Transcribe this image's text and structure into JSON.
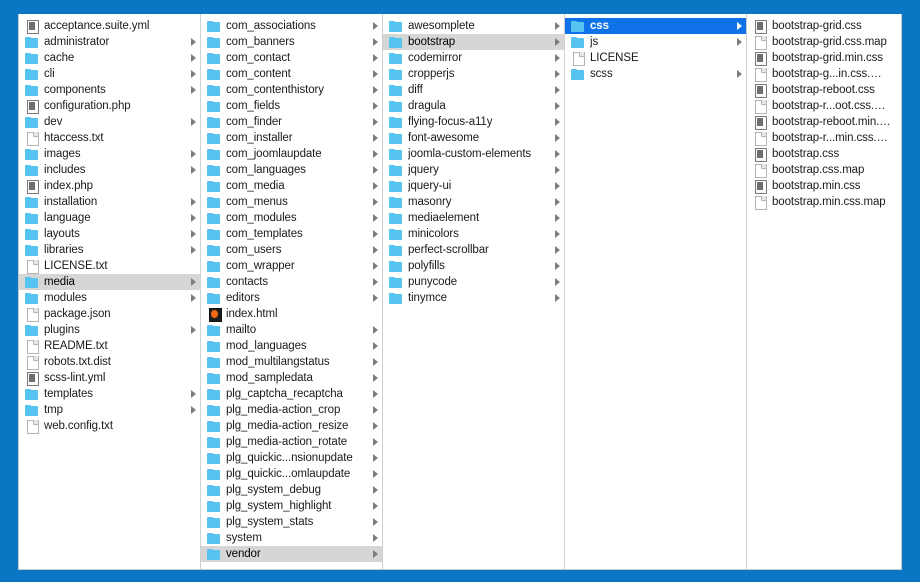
{
  "window": {
    "title": "Finder Column View",
    "desktop_color": "#0a76c4",
    "selection_color": "#1072e8",
    "inactive_selection_color": "#d6d6d6",
    "folder_icon_color": "#57c3f0"
  },
  "columns": [
    {
      "name": "joomla-root",
      "items": [
        {
          "label": "acceptance.suite.yml",
          "icon": "code-file-icon",
          "arrow": false,
          "state": "normal"
        },
        {
          "label": "administrator",
          "icon": "folder-icon",
          "arrow": true,
          "state": "normal"
        },
        {
          "label": "cache",
          "icon": "folder-icon",
          "arrow": true,
          "state": "normal"
        },
        {
          "label": "cli",
          "icon": "folder-icon",
          "arrow": true,
          "state": "normal"
        },
        {
          "label": "components",
          "icon": "folder-icon",
          "arrow": true,
          "state": "normal"
        },
        {
          "label": "configuration.php",
          "icon": "code-file-icon",
          "arrow": false,
          "state": "normal"
        },
        {
          "label": "dev",
          "icon": "folder-icon",
          "arrow": true,
          "state": "normal"
        },
        {
          "label": "htaccess.txt",
          "icon": "document-icon",
          "arrow": false,
          "state": "normal"
        },
        {
          "label": "images",
          "icon": "folder-icon",
          "arrow": true,
          "state": "normal"
        },
        {
          "label": "includes",
          "icon": "folder-icon",
          "arrow": true,
          "state": "normal"
        },
        {
          "label": "index.php",
          "icon": "code-file-icon",
          "arrow": false,
          "state": "normal"
        },
        {
          "label": "installation",
          "icon": "folder-icon",
          "arrow": true,
          "state": "normal"
        },
        {
          "label": "language",
          "icon": "folder-icon",
          "arrow": true,
          "state": "normal"
        },
        {
          "label": "layouts",
          "icon": "folder-icon",
          "arrow": true,
          "state": "normal"
        },
        {
          "label": "libraries",
          "icon": "folder-icon",
          "arrow": true,
          "state": "normal"
        },
        {
          "label": "LICENSE.txt",
          "icon": "document-icon",
          "arrow": false,
          "state": "normal"
        },
        {
          "label": "media",
          "icon": "folder-icon",
          "arrow": true,
          "state": "selected-inactive"
        },
        {
          "label": "modules",
          "icon": "folder-icon",
          "arrow": true,
          "state": "normal"
        },
        {
          "label": "package.json",
          "icon": "document-icon",
          "arrow": false,
          "state": "normal"
        },
        {
          "label": "plugins",
          "icon": "folder-icon",
          "arrow": true,
          "state": "normal"
        },
        {
          "label": "README.txt",
          "icon": "document-icon",
          "arrow": false,
          "state": "normal"
        },
        {
          "label": "robots.txt.dist",
          "icon": "document-icon",
          "arrow": false,
          "state": "normal"
        },
        {
          "label": "scss-lint.yml",
          "icon": "code-file-icon",
          "arrow": false,
          "state": "normal"
        },
        {
          "label": "templates",
          "icon": "folder-icon",
          "arrow": true,
          "state": "normal"
        },
        {
          "label": "tmp",
          "icon": "folder-icon",
          "arrow": true,
          "state": "normal"
        },
        {
          "label": "web.config.txt",
          "icon": "document-icon",
          "arrow": false,
          "state": "normal"
        }
      ]
    },
    {
      "name": "media",
      "items": [
        {
          "label": "com_associations",
          "icon": "folder-icon",
          "arrow": true,
          "state": "normal"
        },
        {
          "label": "com_banners",
          "icon": "folder-icon",
          "arrow": true,
          "state": "normal"
        },
        {
          "label": "com_contact",
          "icon": "folder-icon",
          "arrow": true,
          "state": "normal"
        },
        {
          "label": "com_content",
          "icon": "folder-icon",
          "arrow": true,
          "state": "normal"
        },
        {
          "label": "com_contenthistory",
          "icon": "folder-icon",
          "arrow": true,
          "state": "normal"
        },
        {
          "label": "com_fields",
          "icon": "folder-icon",
          "arrow": true,
          "state": "normal"
        },
        {
          "label": "com_finder",
          "icon": "folder-icon",
          "arrow": true,
          "state": "normal"
        },
        {
          "label": "com_installer",
          "icon": "folder-icon",
          "arrow": true,
          "state": "normal"
        },
        {
          "label": "com_joomlaupdate",
          "icon": "folder-icon",
          "arrow": true,
          "state": "normal"
        },
        {
          "label": "com_languages",
          "icon": "folder-icon",
          "arrow": true,
          "state": "normal"
        },
        {
          "label": "com_media",
          "icon": "folder-icon",
          "arrow": true,
          "state": "normal"
        },
        {
          "label": "com_menus",
          "icon": "folder-icon",
          "arrow": true,
          "state": "normal"
        },
        {
          "label": "com_modules",
          "icon": "folder-icon",
          "arrow": true,
          "state": "normal"
        },
        {
          "label": "com_templates",
          "icon": "folder-icon",
          "arrow": true,
          "state": "normal"
        },
        {
          "label": "com_users",
          "icon": "folder-icon",
          "arrow": true,
          "state": "normal"
        },
        {
          "label": "com_wrapper",
          "icon": "folder-icon",
          "arrow": true,
          "state": "normal"
        },
        {
          "label": "contacts",
          "icon": "folder-icon",
          "arrow": true,
          "state": "normal"
        },
        {
          "label": "editors",
          "icon": "folder-icon",
          "arrow": true,
          "state": "normal"
        },
        {
          "label": "index.html",
          "icon": "html-file-icon",
          "arrow": false,
          "state": "normal"
        },
        {
          "label": "mailto",
          "icon": "folder-icon",
          "arrow": true,
          "state": "normal"
        },
        {
          "label": "mod_languages",
          "icon": "folder-icon",
          "arrow": true,
          "state": "normal"
        },
        {
          "label": "mod_multilangstatus",
          "icon": "folder-icon",
          "arrow": true,
          "state": "normal"
        },
        {
          "label": "mod_sampledata",
          "icon": "folder-icon",
          "arrow": true,
          "state": "normal"
        },
        {
          "label": "plg_captcha_recaptcha",
          "icon": "folder-icon",
          "arrow": true,
          "state": "normal"
        },
        {
          "label": "plg_media-action_crop",
          "icon": "folder-icon",
          "arrow": true,
          "state": "normal"
        },
        {
          "label": "plg_media-action_resize",
          "icon": "folder-icon",
          "arrow": true,
          "state": "normal"
        },
        {
          "label": "plg_media-action_rotate",
          "icon": "folder-icon",
          "arrow": true,
          "state": "normal"
        },
        {
          "label": "plg_quickic...nsionupdate",
          "icon": "folder-icon",
          "arrow": true,
          "state": "normal"
        },
        {
          "label": "plg_quickic...omlaupdate",
          "icon": "folder-icon",
          "arrow": true,
          "state": "normal"
        },
        {
          "label": "plg_system_debug",
          "icon": "folder-icon",
          "arrow": true,
          "state": "normal"
        },
        {
          "label": "plg_system_highlight",
          "icon": "folder-icon",
          "arrow": true,
          "state": "normal"
        },
        {
          "label": "plg_system_stats",
          "icon": "folder-icon",
          "arrow": true,
          "state": "normal"
        },
        {
          "label": "system",
          "icon": "folder-icon",
          "arrow": true,
          "state": "normal"
        },
        {
          "label": "vendor",
          "icon": "folder-icon",
          "arrow": true,
          "state": "selected-inactive"
        }
      ]
    },
    {
      "name": "vendor",
      "items": [
        {
          "label": "awesomplete",
          "icon": "folder-icon",
          "arrow": true,
          "state": "normal"
        },
        {
          "label": "bootstrap",
          "icon": "folder-icon",
          "arrow": true,
          "state": "selected-inactive"
        },
        {
          "label": "codemirror",
          "icon": "folder-icon",
          "arrow": true,
          "state": "normal"
        },
        {
          "label": "cropperjs",
          "icon": "folder-icon",
          "arrow": true,
          "state": "normal"
        },
        {
          "label": "diff",
          "icon": "folder-icon",
          "arrow": true,
          "state": "normal"
        },
        {
          "label": "dragula",
          "icon": "folder-icon",
          "arrow": true,
          "state": "normal"
        },
        {
          "label": "flying-focus-a11y",
          "icon": "folder-icon",
          "arrow": true,
          "state": "normal"
        },
        {
          "label": "font-awesome",
          "icon": "folder-icon",
          "arrow": true,
          "state": "normal"
        },
        {
          "label": "joomla-custom-elements",
          "icon": "folder-icon",
          "arrow": true,
          "state": "normal"
        },
        {
          "label": "jquery",
          "icon": "folder-icon",
          "arrow": true,
          "state": "normal"
        },
        {
          "label": "jquery-ui",
          "icon": "folder-icon",
          "arrow": true,
          "state": "normal"
        },
        {
          "label": "masonry",
          "icon": "folder-icon",
          "arrow": true,
          "state": "normal"
        },
        {
          "label": "mediaelement",
          "icon": "folder-icon",
          "arrow": true,
          "state": "normal"
        },
        {
          "label": "minicolors",
          "icon": "folder-icon",
          "arrow": true,
          "state": "normal"
        },
        {
          "label": "perfect-scrollbar",
          "icon": "folder-icon",
          "arrow": true,
          "state": "normal"
        },
        {
          "label": "polyfills",
          "icon": "folder-icon",
          "arrow": true,
          "state": "normal"
        },
        {
          "label": "punycode",
          "icon": "folder-icon",
          "arrow": true,
          "state": "normal"
        },
        {
          "label": "tinymce",
          "icon": "folder-icon",
          "arrow": true,
          "state": "normal"
        }
      ]
    },
    {
      "name": "bootstrap",
      "items": [
        {
          "label": "css",
          "icon": "folder-icon",
          "arrow": true,
          "state": "selected-active"
        },
        {
          "label": "js",
          "icon": "folder-icon",
          "arrow": true,
          "state": "normal"
        },
        {
          "label": "LICENSE",
          "icon": "document-icon",
          "arrow": false,
          "state": "normal"
        },
        {
          "label": "scss",
          "icon": "folder-icon",
          "arrow": true,
          "state": "normal"
        }
      ]
    },
    {
      "name": "css",
      "items": [
        {
          "label": "bootstrap-grid.css",
          "icon": "code-file-icon",
          "arrow": false,
          "state": "normal"
        },
        {
          "label": "bootstrap-grid.css.map",
          "icon": "document-icon",
          "arrow": false,
          "state": "normal"
        },
        {
          "label": "bootstrap-grid.min.css",
          "icon": "code-file-icon",
          "arrow": false,
          "state": "normal"
        },
        {
          "label": "bootstrap-g...in.css.map",
          "icon": "document-icon",
          "arrow": false,
          "state": "normal"
        },
        {
          "label": "bootstrap-reboot.css",
          "icon": "code-file-icon",
          "arrow": false,
          "state": "normal"
        },
        {
          "label": "bootstrap-r...oot.css.map",
          "icon": "document-icon",
          "arrow": false,
          "state": "normal"
        },
        {
          "label": "bootstrap-reboot.min.css",
          "icon": "code-file-icon",
          "arrow": false,
          "state": "normal"
        },
        {
          "label": "bootstrap-r...min.css.map",
          "icon": "document-icon",
          "arrow": false,
          "state": "normal"
        },
        {
          "label": "bootstrap.css",
          "icon": "code-file-icon",
          "arrow": false,
          "state": "normal"
        },
        {
          "label": "bootstrap.css.map",
          "icon": "document-icon",
          "arrow": false,
          "state": "normal"
        },
        {
          "label": "bootstrap.min.css",
          "icon": "code-file-icon",
          "arrow": false,
          "state": "normal"
        },
        {
          "label": "bootstrap.min.css.map",
          "icon": "document-icon",
          "arrow": false,
          "state": "normal"
        }
      ]
    }
  ]
}
